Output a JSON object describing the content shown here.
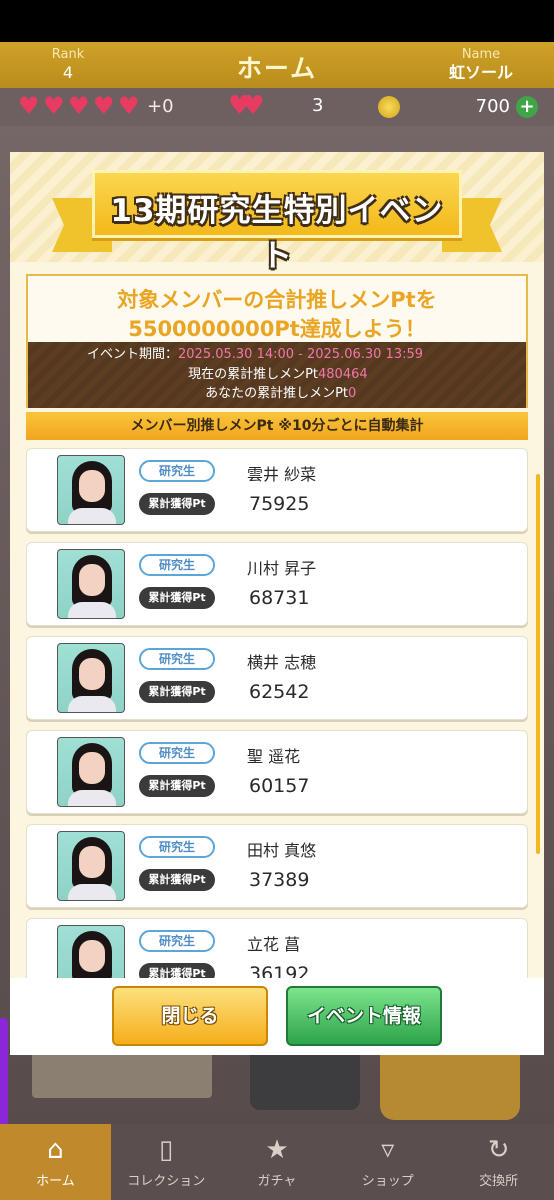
{
  "header": {
    "rank_label": "Rank",
    "rank_value": "4",
    "title": "ホーム",
    "name_label": "Name",
    "name_value": "虹ソール"
  },
  "resources": {
    "hearts_plus": "+0",
    "double_heart_count": "3",
    "coins": "700"
  },
  "modal": {
    "title": "13期研究生特別イベント",
    "goal_line1": "対象メンバーの合計推しメンPtを",
    "goal_line2": "5500000000Pt達成しよう！",
    "period_label": "イベント期間：",
    "period_value": "2025.05.30 14:00 - 2025.06.30 13:59",
    "current_label": "現在の累計推しメンPt",
    "current_value": "480464",
    "yours_label": "あなたの累計推しメンPt",
    "yours_value": "0",
    "list_header": "メンバー別推しメンPt ※10分ごとに自動集計",
    "tag_label": "研究生",
    "pt_label": "累計獲得Pt",
    "members": [
      {
        "name": "雲井 紗菜",
        "pt": "75925"
      },
      {
        "name": "川村 昇子",
        "pt": "68731"
      },
      {
        "name": "横井 志穂",
        "pt": "62542"
      },
      {
        "name": "聖 遥花",
        "pt": "60157"
      },
      {
        "name": "田村 真悠",
        "pt": "37389"
      },
      {
        "name": "立花 菖",
        "pt": "36192"
      }
    ],
    "close_button": "閉じる",
    "event_info_button": "イベント情報"
  },
  "bottom_nav": [
    {
      "label": "ホーム",
      "icon": "home-icon",
      "active": true
    },
    {
      "label": "コレクション",
      "icon": "collection-icon",
      "active": false
    },
    {
      "label": "ガチャ",
      "icon": "gacha-icon",
      "active": false
    },
    {
      "label": "ショップ",
      "icon": "cart-icon",
      "active": false
    },
    {
      "label": "交換所",
      "icon": "exchange-icon",
      "active": false
    }
  ],
  "colors": {
    "accent_gold": "#f2b91a",
    "heart_pink": "#e83b61",
    "green": "#2ea34a"
  }
}
